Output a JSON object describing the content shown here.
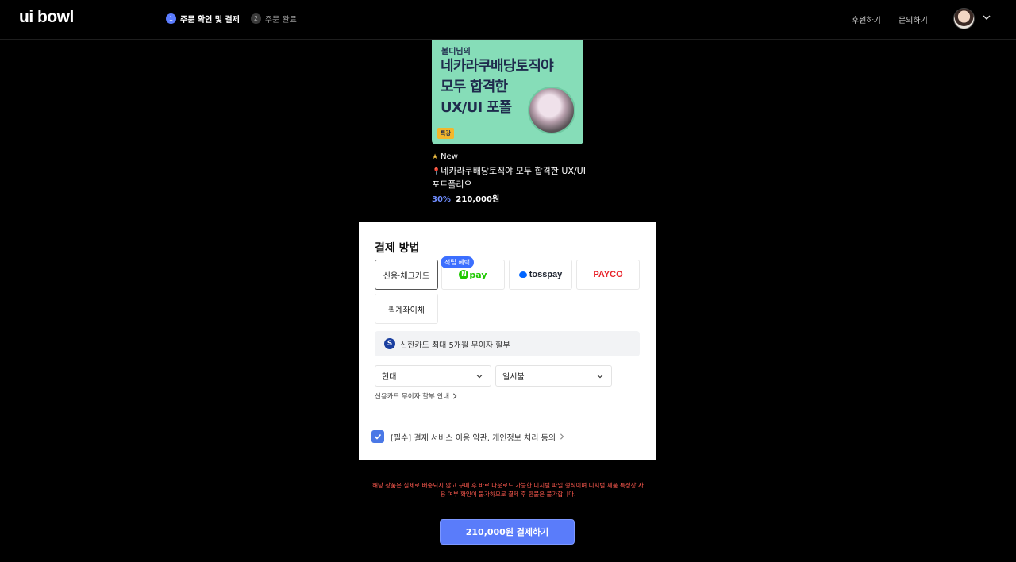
{
  "header": {
    "logo": "ui bowl",
    "steps": [
      {
        "num": "1",
        "label": "주문 확인 및 결제",
        "active": true
      },
      {
        "num": "2",
        "label": "주문 완료",
        "active": false
      }
    ],
    "nav": {
      "sponsor": "후원하기",
      "inquiry": "문의하기"
    },
    "icons": {
      "avatar": "user-avatar",
      "menu": "chevron-down-icon"
    }
  },
  "product": {
    "thumbnail": {
      "subtitle": "볼디님의",
      "line1": "네카라쿠배당토직야",
      "line2": "모두 합격한",
      "line3": "UX/UI 포폴",
      "badge": "특강"
    },
    "new_label": "New",
    "title": "네카라쿠배당토직야 모두 합격한 UX/UI 포트폴리오",
    "discount": "30%",
    "price": "210,000원"
  },
  "payment": {
    "title": "결제 방법",
    "methods": [
      "신용·체크카드",
      "pay",
      "tosspay",
      "PAYCO",
      "퀵계좌이체"
    ],
    "npay_benefit": "적립 혜택",
    "selected_method": "신용·체크카드",
    "promo": "신한카드 최대 5개월 무이자 할부",
    "card_select": "현대",
    "installment_select": "일시불",
    "installment_link": "신용카드 무이자 할부 안내",
    "consent": "[필수] 결제 서비스 이용 약관, 개인정보 처리 동의",
    "consent_checked": true
  },
  "notice": "해당 상품은 실제로 배송되지 않고 구매 후 바로 다운로드 가능한 디지털 파일 형식이며 디지털 제품 특성상 사용 여부 확인이 불가하므로 결제 후 환불은 불가합니다.",
  "pay_button": "210,000원 결제하기",
  "colors": {
    "accent": "#5a7cfa",
    "warning": "#ff5a4f",
    "npay": "#1ec800",
    "payco": "#e8232a",
    "thumbnail_bg": "#86ddb8"
  }
}
